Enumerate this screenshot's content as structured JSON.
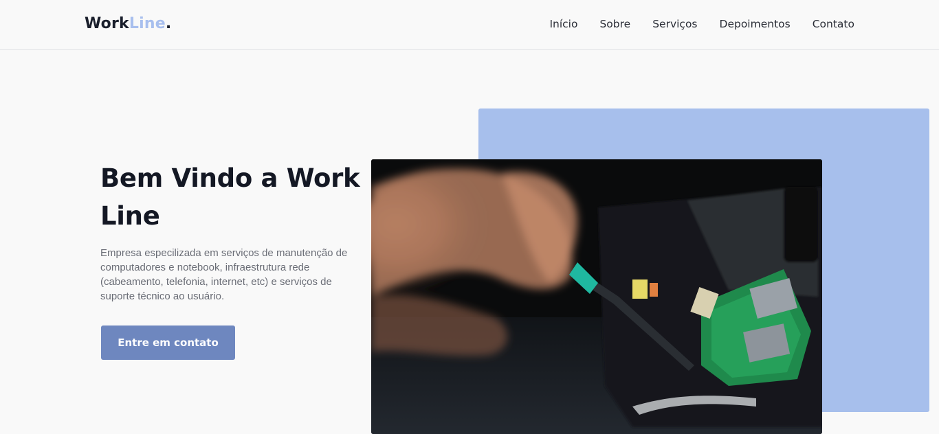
{
  "brand": {
    "logo_part1": "Work",
    "logo_part2": "Line",
    "logo_part3": ".",
    "accent_color": "#a8bfee"
  },
  "nav": {
    "items": [
      {
        "label": "Início"
      },
      {
        "label": "Sobre"
      },
      {
        "label": "Serviços"
      },
      {
        "label": "Depoimentos"
      },
      {
        "label": "Contato"
      }
    ]
  },
  "hero": {
    "title": "Bem Vindo a Work Line",
    "description": "Empresa especilizada em serviços de manutenção de computadores e notebook, infraestrutura rede (cabeamento, telefonia, internet, etc) e serviços de suporte técnico ao usuário.",
    "cta_label": "Entre em contato",
    "cta_color": "#6e87bf",
    "accent_block_color": "#a7bfec",
    "image_icon": "circuit-board-repair-photo"
  }
}
